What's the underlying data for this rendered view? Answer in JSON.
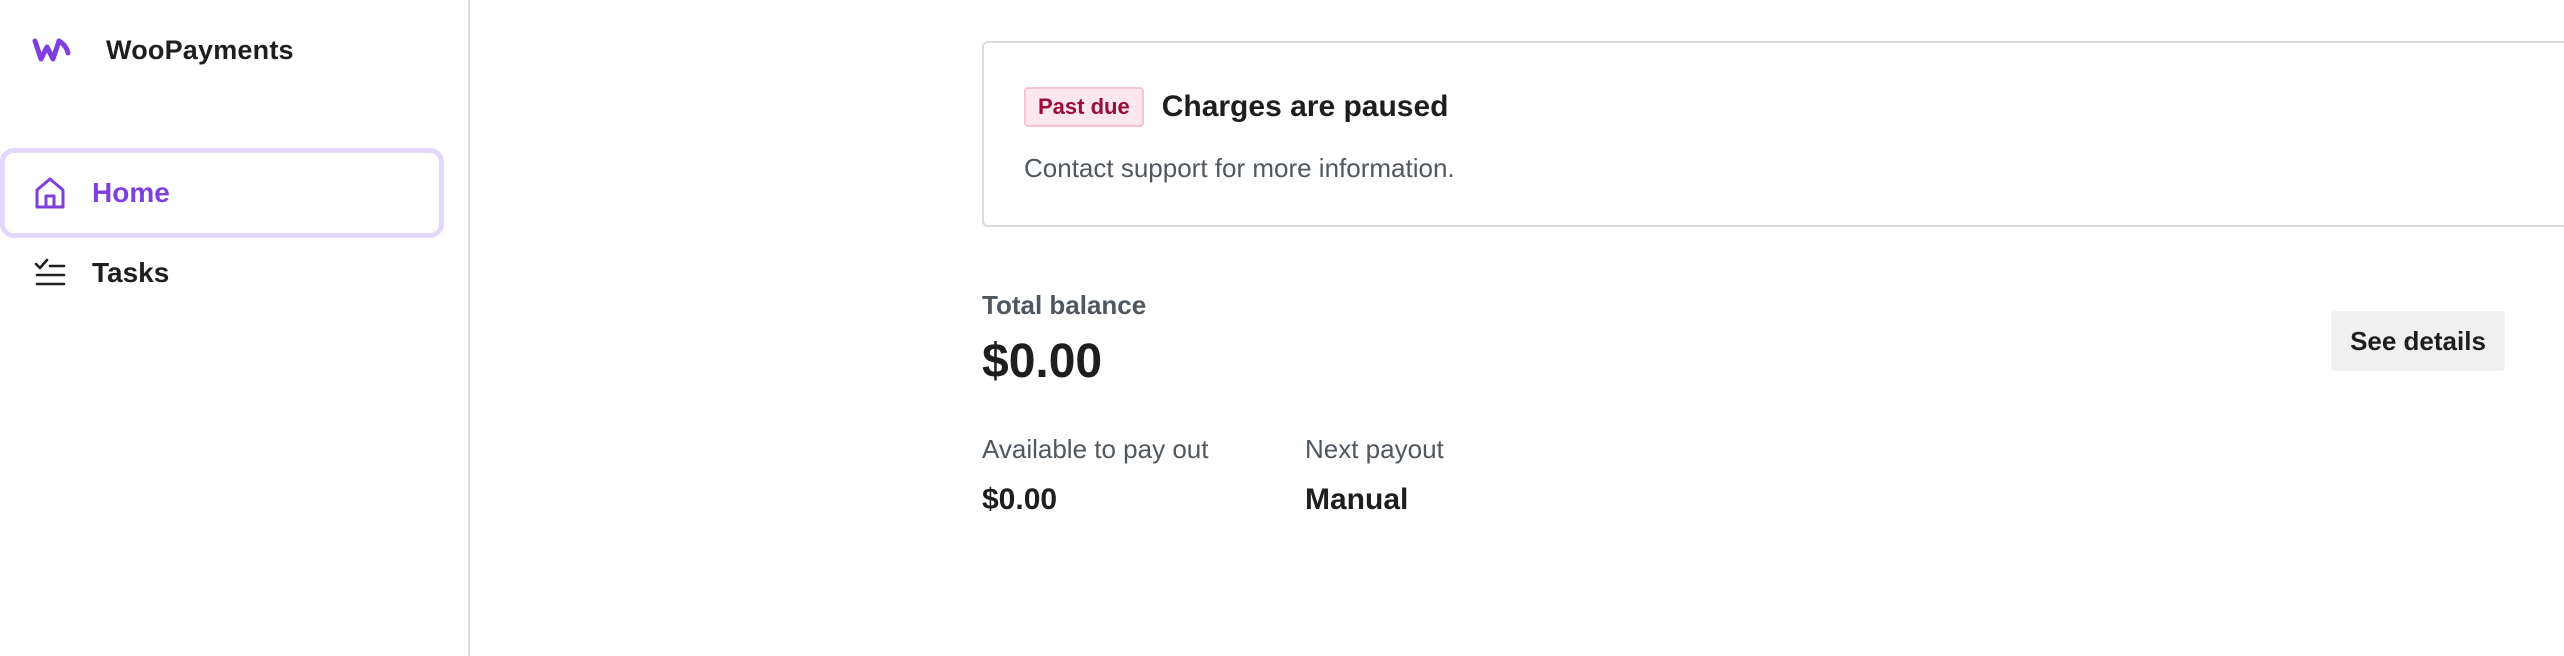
{
  "sidebar": {
    "brand": {
      "name": "WooPayments",
      "logo_icon": "woo-logo",
      "logo_color": "#7f3fe0"
    },
    "items": [
      {
        "label": "Home",
        "icon": "home-icon",
        "active": true
      },
      {
        "label": "Tasks",
        "icon": "tasks-icon",
        "active": false
      }
    ],
    "accent_color": "#7f3fe0"
  },
  "notice": {
    "badge": "Past due",
    "title": "Charges are paused",
    "text": "Contact support for more information."
  },
  "balance": {
    "label": "Total balance",
    "value": "$0.00",
    "see_details_label": "See details"
  },
  "stats": [
    {
      "label": "Available to pay out",
      "value": "$0.00"
    },
    {
      "label": "Next payout",
      "value": "Manual"
    }
  ]
}
